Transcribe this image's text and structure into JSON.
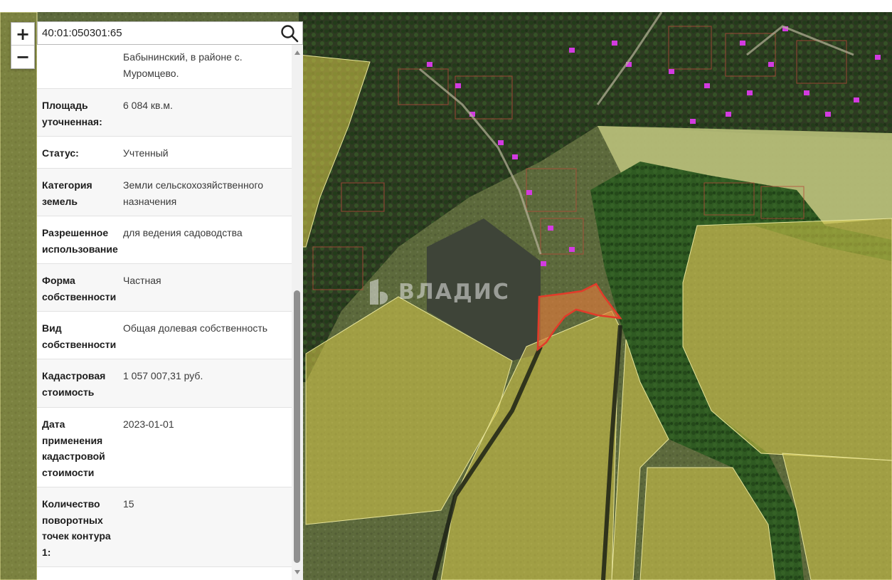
{
  "search": {
    "value": "40:01:050301:65"
  },
  "zoom": {
    "in_label": "+",
    "out_label": "−"
  },
  "watermark": "ВЛАДИС",
  "rows": [
    {
      "key": "",
      "value": "Бабынинский, в районе с. Муромцево."
    },
    {
      "key": "Площадь уточненная:",
      "value": "6 084 кв.м."
    },
    {
      "key": "Статус:",
      "value": "Учтенный"
    },
    {
      "key": "Категория земель",
      "value": "Земли сельскохозяйственного назначения"
    },
    {
      "key": "Разрешенное использование",
      "value": "для ведения садоводства"
    },
    {
      "key": "Форма собственности",
      "value": "Частная"
    },
    {
      "key": "Вид собственности",
      "value": "Общая долевая собственность"
    },
    {
      "key": "Кадастровая стоимость",
      "value": "1 057 007,31 руб."
    },
    {
      "key": "Дата применения кадастровой стоимости",
      "value": "2023-01-01"
    },
    {
      "key": "Количество поворотных точек контура 1:",
      "value": "15"
    }
  ],
  "colors": {
    "parcel_fill": "#e8d24a",
    "selected_parcel": "#e23b2a",
    "building": "#d23be0",
    "forest": "#2d5a1f",
    "field": "#8a8c45"
  },
  "icons": {
    "search": "search-icon",
    "scroll_up": "chevron-up-icon",
    "scroll_down": "chevron-down-icon"
  }
}
